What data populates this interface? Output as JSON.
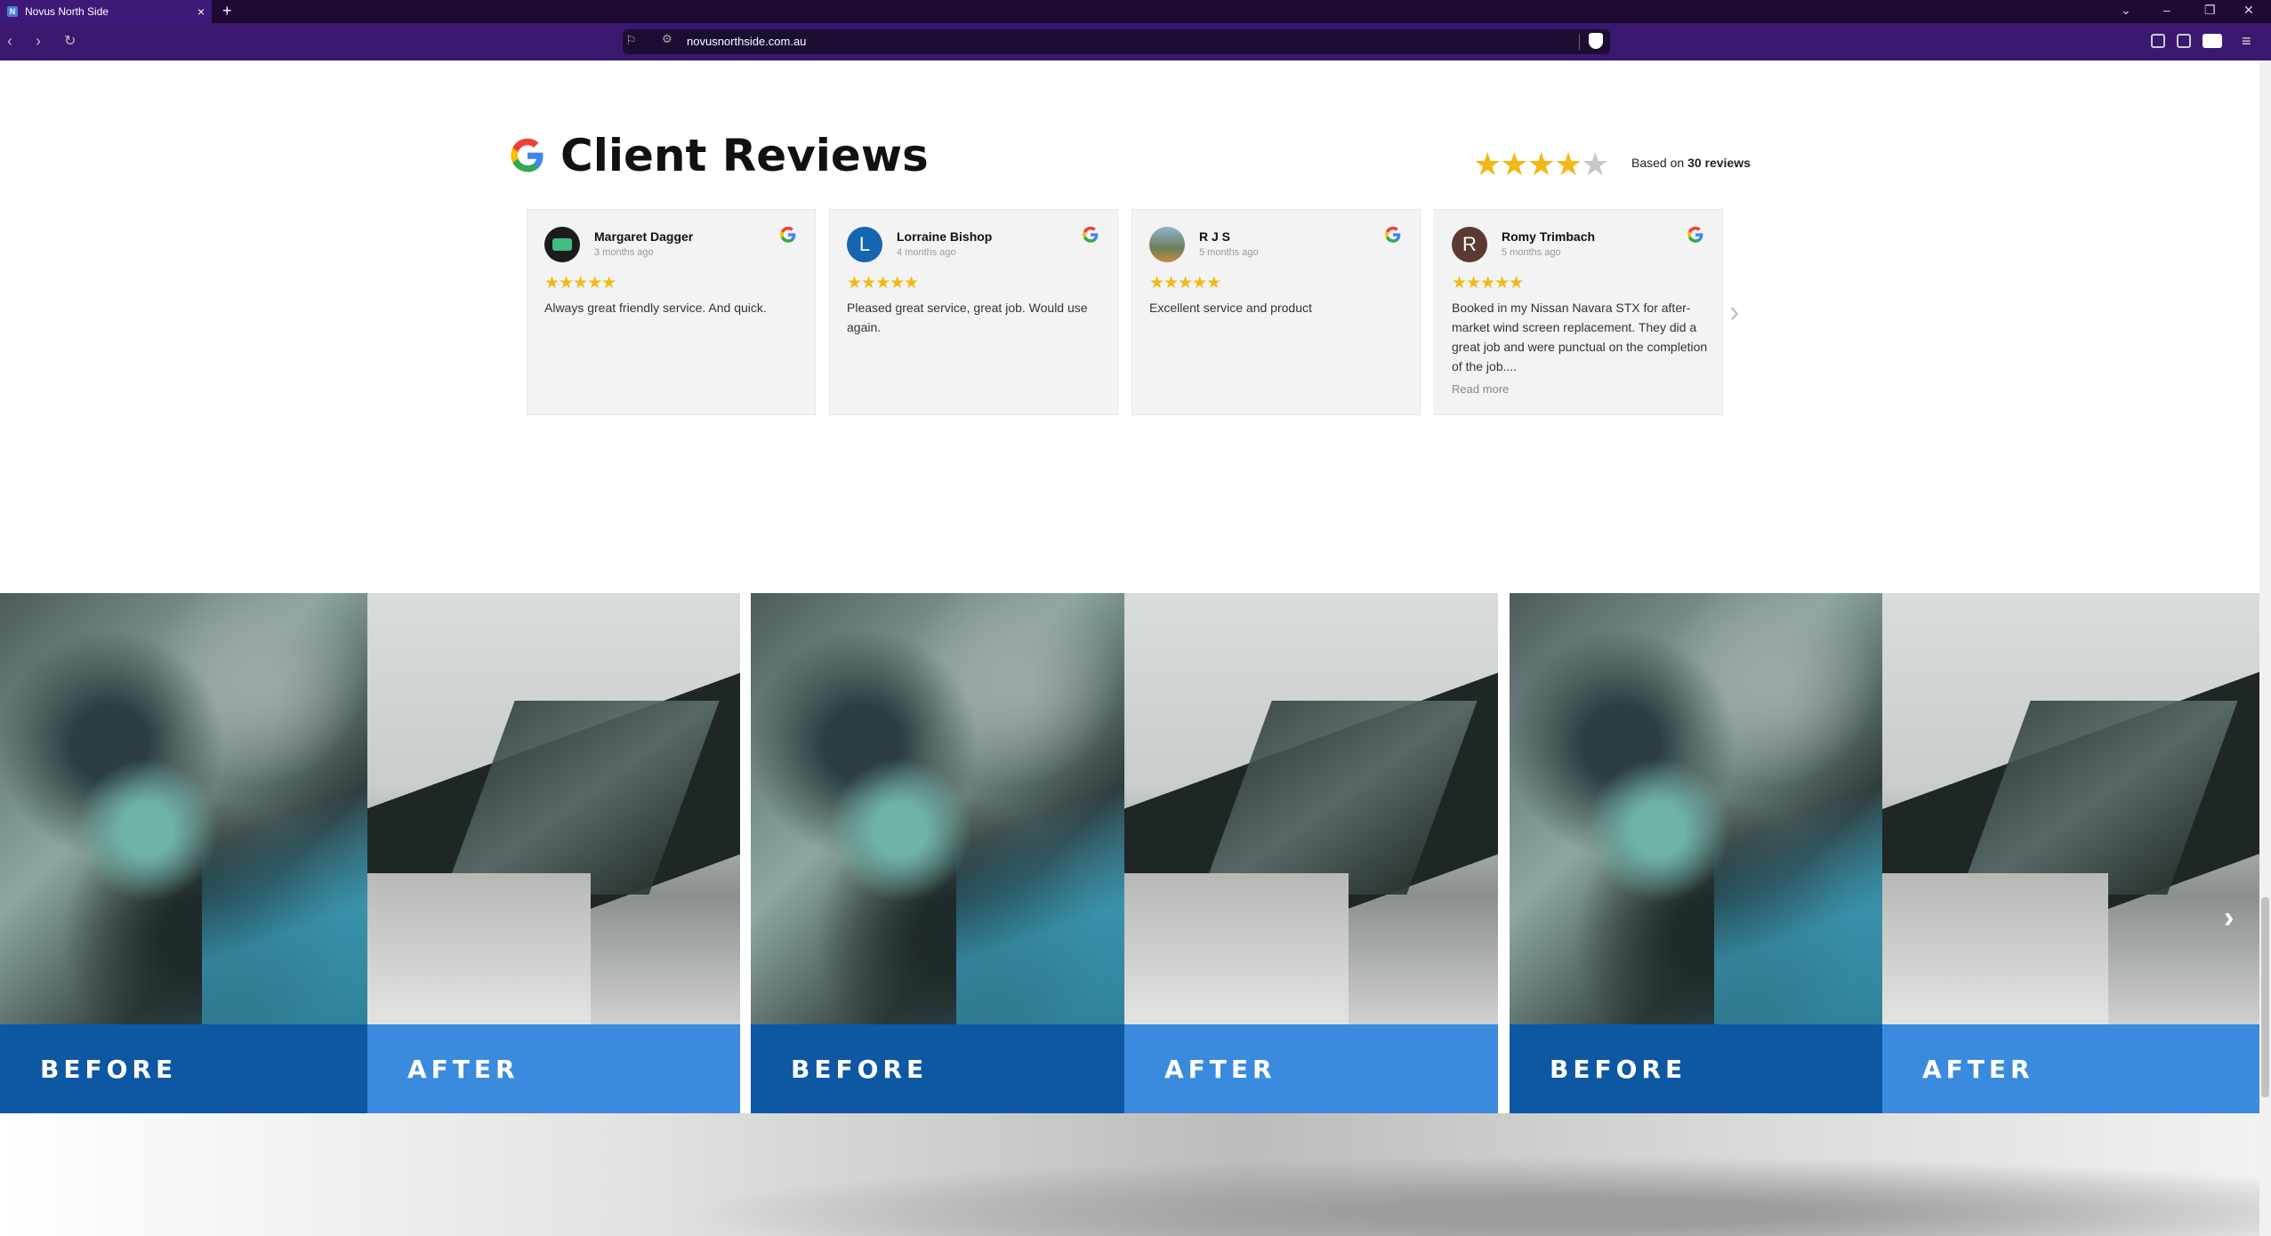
{
  "browser": {
    "tab_title": "Novus North Side",
    "tab_favicon_letter": "N",
    "url": "novusnorthside.com.au"
  },
  "reviews": {
    "title": "Client Reviews",
    "overall_rating": 4,
    "based_on_prefix": "Based on ",
    "based_on_count": "30 reviews",
    "items": [
      {
        "name": "Margaret Dagger",
        "time": "3 months ago",
        "avatar_letter": "",
        "avatar_color": "#1b1b1b",
        "stars": "★★★★★",
        "text": "Always great friendly service. And quick.",
        "more": ""
      },
      {
        "name": "Lorraine Bishop",
        "time": "4 months ago",
        "avatar_letter": "L",
        "avatar_color": "#1565b0",
        "stars": "★★★★★",
        "text": "Pleased great service, great job. Would use again.",
        "more": ""
      },
      {
        "name": "R J S",
        "time": "5 months ago",
        "avatar_letter": "",
        "avatar_color": "#7b93a9",
        "stars": "★★★★★",
        "text": "Excellent service and product",
        "more": ""
      },
      {
        "name": "Romy Trimbach",
        "time": "5 months ago",
        "avatar_letter": "R",
        "avatar_color": "#5b3a31",
        "stars": "★★★★★",
        "text": "Booked in my Nissan Navara STX for after-market wind screen replacement. They did a great job and were punctual on the completion of the job....",
        "more": "Read more"
      }
    ],
    "next_icon": "chevron-right-icon"
  },
  "before_after": {
    "before_label": "BEFORE",
    "after_label": "AFTER",
    "before_color": "#0e57a3",
    "after_color": "#3a8bde",
    "pairs": 3
  },
  "colors": {
    "tabbar": "#1e0a33",
    "navbar": "#3a1870",
    "star": "#f1b915"
  }
}
